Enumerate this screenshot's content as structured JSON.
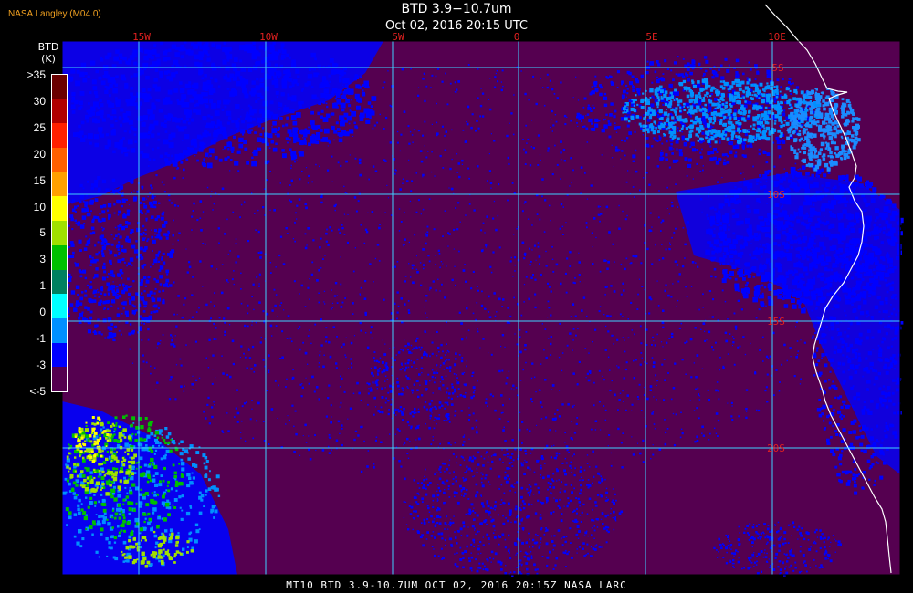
{
  "header": {
    "title": "BTD 3.9−10.7um",
    "date": "Oct 02, 2016 20:15 UTC",
    "producer": "NASA Langley (M04.0)"
  },
  "legend": {
    "units_top": "BTD",
    "units_bottom": "(K)",
    "labels": [
      ">35",
      "30",
      "25",
      "20",
      "15",
      "10",
      "5",
      "3",
      "1",
      "0",
      "-1",
      "-3",
      "<-5"
    ],
    "colors": [
      "#6a0000",
      "#b00000",
      "#ff2000",
      "#ff6000",
      "#ffa000",
      "#ffff00",
      "#a0e000",
      "#00c000",
      "#008060",
      "#00ffff",
      "#0090ff",
      "#0000ff",
      "#550050"
    ]
  },
  "map": {
    "longitude_labels": [
      "15W",
      "10W",
      "5W",
      "0",
      "5E",
      "10E"
    ],
    "latitude_labels": [
      "5S",
      "10S",
      "15S",
      "20S"
    ],
    "background_color": "#550050",
    "grid_color": "#40d0ff",
    "coast_color": "#ffffff"
  },
  "footer": "MT10  BTD 3.9-10.7UM  OCT 02, 2016 20:15Z  NASA LARC"
}
